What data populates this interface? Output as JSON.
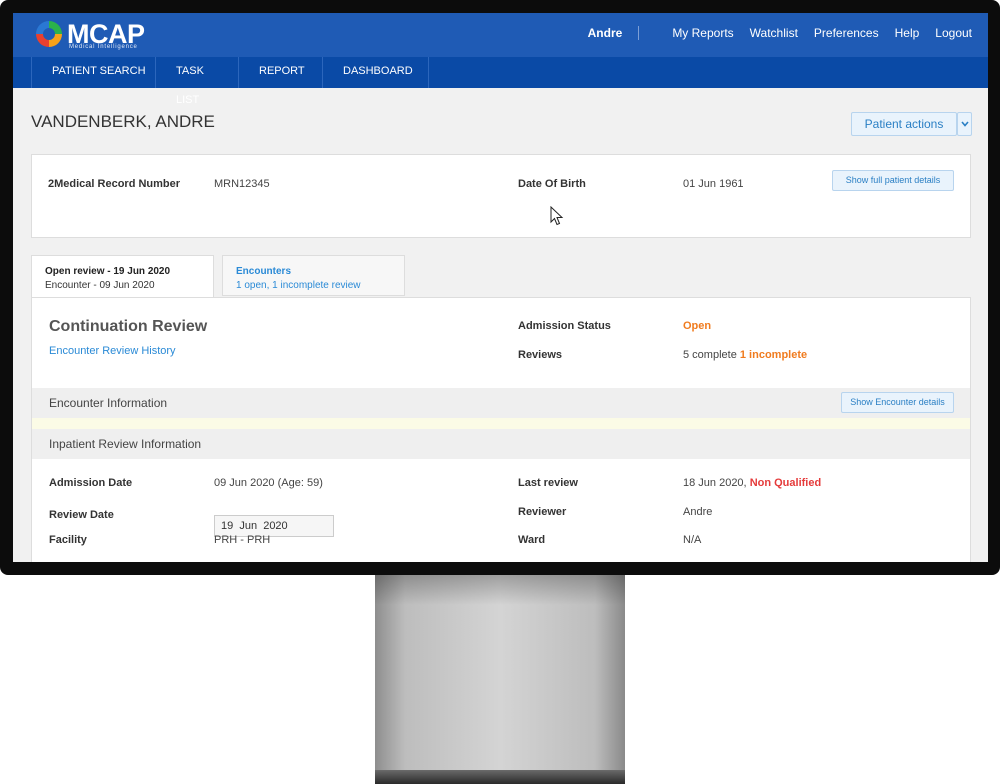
{
  "header": {
    "logo_text": "MCAP",
    "logo_sub": "Medical Intelligence",
    "user": "Andre",
    "links": [
      "My Reports",
      "Watchlist",
      "Preferences",
      "Help",
      "Logout"
    ]
  },
  "subnav": {
    "tabs": [
      "PATIENT SEARCH",
      "TASK LIST",
      "REPORT",
      "DASHBOARD"
    ]
  },
  "patient": {
    "name": "VANDENBERK, ANDRE",
    "actions_label": "Patient actions",
    "mrn_label": "2Medical Record Number",
    "mrn_value": "MRN12345",
    "dob_label": "Date Of Birth",
    "dob_value": "01 Jun 1961",
    "show_details_label": "Show full patient details"
  },
  "review_tabs": [
    {
      "line1": "Open review - 19 Jun 2020",
      "line2": "Encounter - 09 Jun 2020"
    },
    {
      "line1": "Encounters",
      "line2": "1 open, 1 incomplete review"
    }
  ],
  "review": {
    "title": "Continuation Review",
    "history_link": "Encounter Review History",
    "admission_status_label": "Admission Status",
    "admission_status_value": "Open",
    "reviews_label": "Reviews",
    "reviews_complete": "5 complete",
    "reviews_incomplete": "1 incomplete",
    "encounter_info_label": "Encounter Information",
    "show_encounter_label": "Show Encounter details",
    "inpatient_label": "Inpatient Review Information",
    "admission_date_label": "Admission Date",
    "admission_date_value": "09 Jun 2020 (Age: 59)",
    "review_date_label": "Review Date",
    "review_date_value": "19  Jun  2020",
    "facility_label": "Facility",
    "facility_value": "PRH - PRH",
    "last_review_label": "Last review",
    "last_review_date": "18 Jun 2020,",
    "last_review_status": "Non Qualified",
    "reviewer_label": "Reviewer",
    "reviewer_value": "Andre",
    "ward_label": "Ward",
    "ward_value": "N/A"
  },
  "colors": {
    "topbar": "#1f5bb5",
    "subnav": "#0a4aa6",
    "link": "#2a8ad6",
    "orange": "#f07b1e",
    "red": "#e53b3b"
  }
}
